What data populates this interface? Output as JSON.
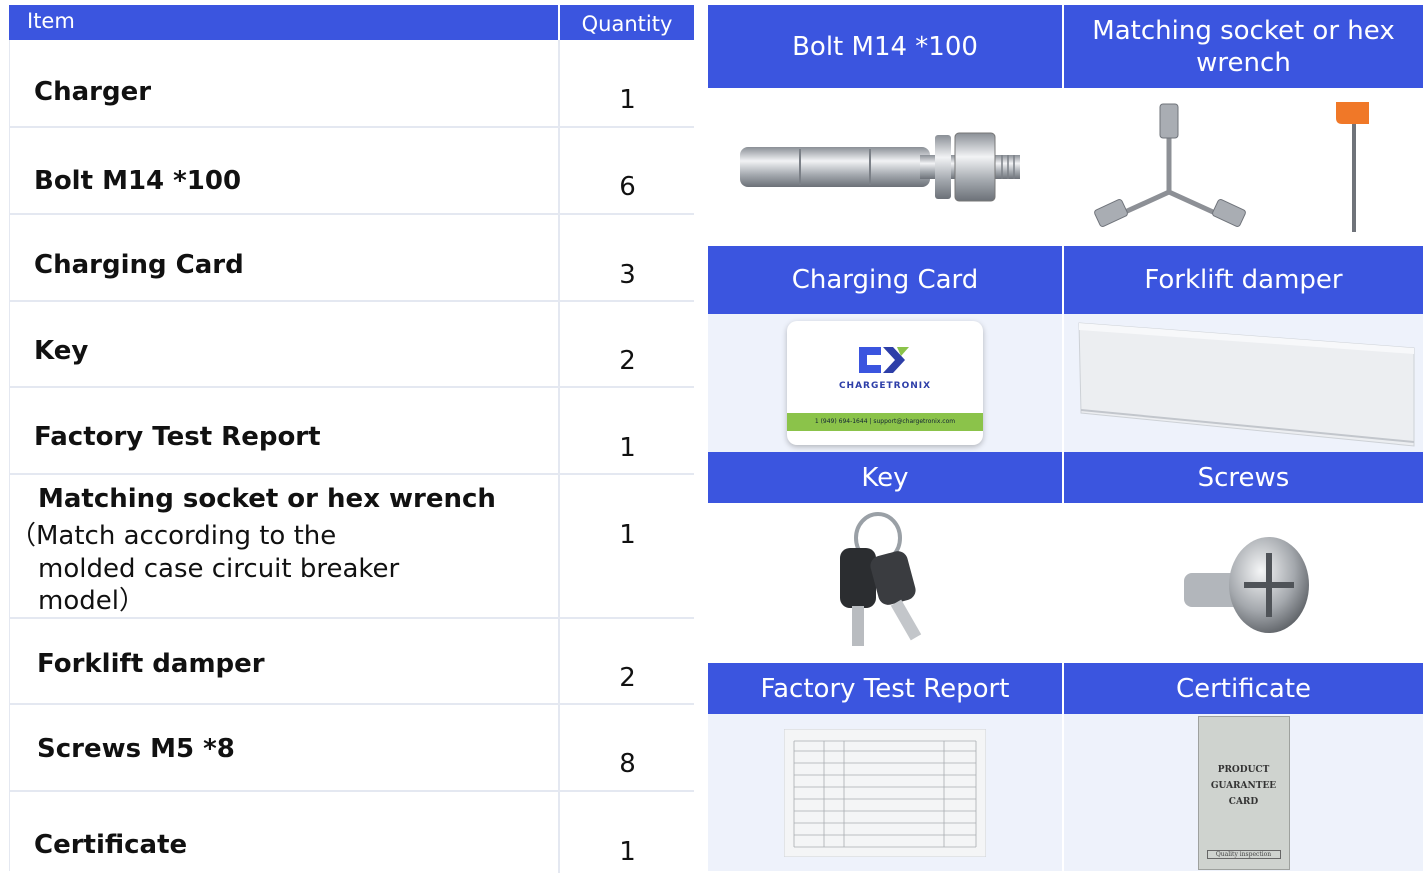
{
  "table": {
    "header_item": "Item",
    "header_quantity": "Quantity",
    "rows": [
      {
        "item": "Charger",
        "qty": "1"
      },
      {
        "item": "Bolt M14 *100",
        "qty": "6"
      },
      {
        "item": "Charging Card",
        "qty": "3"
      },
      {
        "item": "Key",
        "qty": "2"
      },
      {
        "item": "Factory Test Report",
        "qty": "1"
      },
      {
        "item": "Matching socket or hex wrench",
        "qty": "1",
        "note_1": "（Match according to the",
        "note_2": "molded  case circuit breaker",
        "note_3": "model）"
      },
      {
        "item": "Forklift damper",
        "qty": "2"
      },
      {
        "item": "Screws  M5 *8",
        "qty": "8"
      },
      {
        "item": "Certificate",
        "qty": "1"
      }
    ]
  },
  "gallery": {
    "bolt": "Bolt M14 *100",
    "wrench": "Matching socket or hex wrench",
    "card": "Charging Card",
    "damper": "Forklift damper",
    "key": "Key",
    "screws": "Screws",
    "report": "Factory Test Report",
    "certificate": "Certificate",
    "card_brand": "CHARGETRONIX",
    "card_contact": "1 (949) 694-1644 | support@chargetronix.com",
    "cert_line1": "PRODUCT",
    "cert_line2": "GUARANTEE",
    "cert_line3": "CARD",
    "cert_stamp": "Quality inspection"
  },
  "colors": {
    "header_blue": "#3b55df",
    "panel_bg": "#eef2fb",
    "card_green": "#8bc34a"
  }
}
